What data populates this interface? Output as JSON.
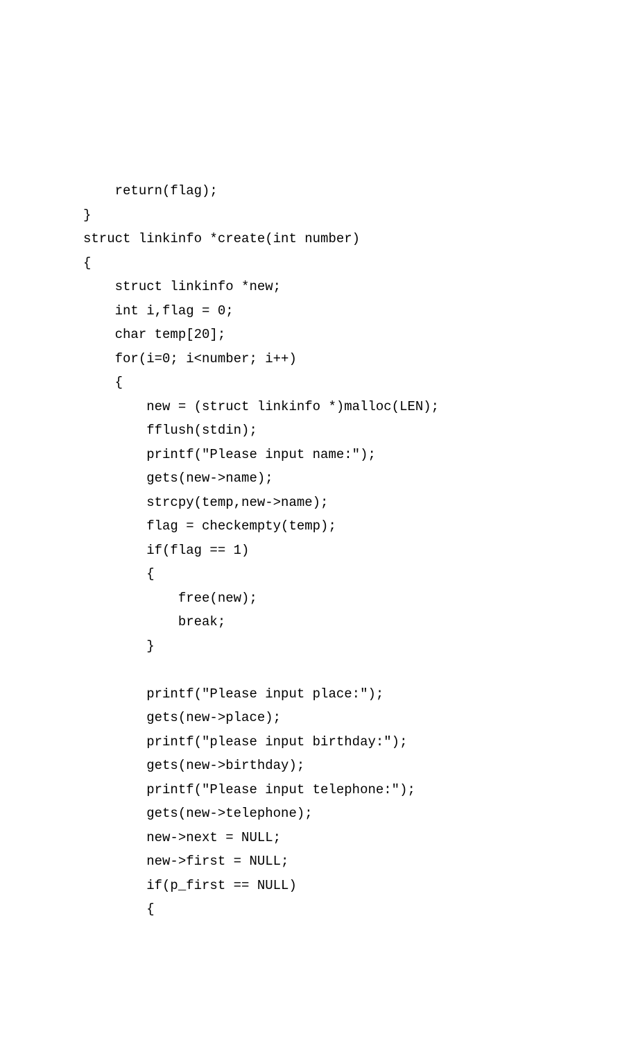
{
  "code": {
    "lines": [
      "    return(flag);",
      "}",
      "struct linkinfo *create(int number)",
      "{",
      "    struct linkinfo *new;",
      "    int i,flag = 0;",
      "    char temp[20];",
      "    for(i=0; i<number; i++)",
      "    {",
      "        new = (struct linkinfo *)malloc(LEN);",
      "        fflush(stdin);",
      "        printf(\"Please input name:\");",
      "        gets(new->name);",
      "        strcpy(temp,new->name);",
      "        flag = checkempty(temp);",
      "        if(flag == 1)",
      "        {",
      "            free(new);",
      "            break;",
      "        }",
      "",
      "        printf(\"Please input place:\");",
      "        gets(new->place);",
      "        printf(\"please input birthday:\");",
      "        gets(new->birthday);",
      "        printf(\"Please input telephone:\");",
      "        gets(new->telephone);",
      "        new->next = NULL;",
      "        new->first = NULL;",
      "        if(p_first == NULL)",
      "        {"
    ]
  }
}
